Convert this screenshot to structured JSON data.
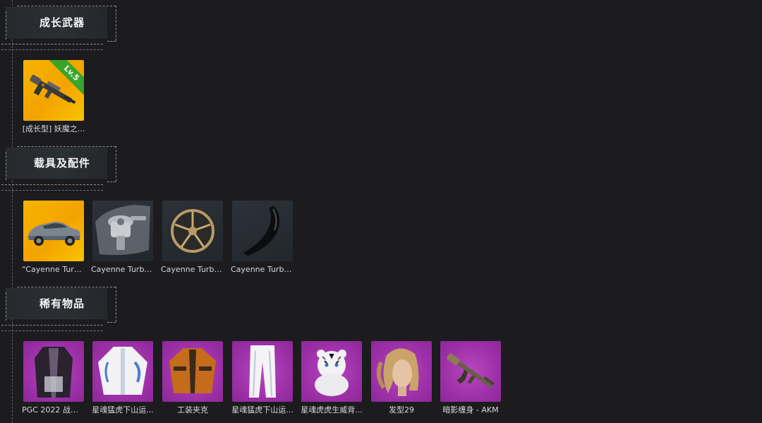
{
  "sections": [
    {
      "title": "成长武器",
      "items": [
        {
          "label": "[成长型] 妖魔之...",
          "bg": "gold",
          "icon": "rifle-icon",
          "badge": "Lv.5"
        }
      ]
    },
    {
      "title": "载具及配件",
      "items": [
        {
          "label": "“Cayenne Turb...",
          "bg": "gold",
          "icon": "car-icon"
        },
        {
          "label": "Cayenne Turbo...",
          "bg": "slate",
          "icon": "paint-gun-icon"
        },
        {
          "label": "Cayenne Turbo...",
          "bg": "slate",
          "icon": "wheel-icon"
        },
        {
          "label": "Cayenne Turbo...",
          "bg": "slate",
          "icon": "spoiler-icon"
        }
      ]
    },
    {
      "title": "稀有物品",
      "items": [
        {
          "label": "PGC 2022 战术...",
          "bg": "purple",
          "icon": "coat-icon"
        },
        {
          "label": "星魂猛虎下山运...",
          "bg": "purple",
          "icon": "jacket-icon"
        },
        {
          "label": "工装夹克",
          "bg": "purple",
          "icon": "work-jacket-icon"
        },
        {
          "label": "星魂猛虎下山运...",
          "bg": "purple",
          "icon": "pants-icon"
        },
        {
          "label": "星魂虎虎生威背...",
          "bg": "purple",
          "icon": "tiger-backpack-icon"
        },
        {
          "label": "发型29",
          "bg": "purple",
          "icon": "hairstyle-icon"
        },
        {
          "label": "暗影缠身 - AKM",
          "bg": "purple",
          "icon": "akm-rifle-icon"
        }
      ]
    }
  ],
  "colors": {
    "background": "#1c1c1f",
    "gold_tile": "#f4a300",
    "purple_tile": "#9a2ea5",
    "slate_tile": "#262b31",
    "level_badge": "#39a52a"
  }
}
